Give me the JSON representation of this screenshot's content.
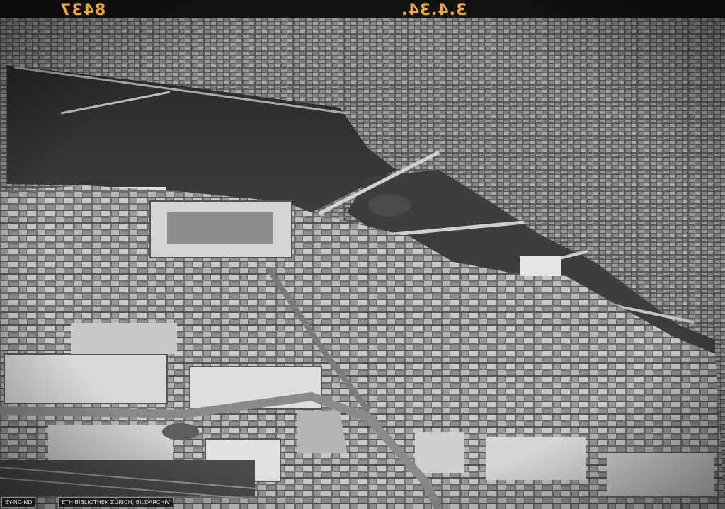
{
  "photo": {
    "negative_number_left": "8437",
    "negative_number_right": "3.4.34.",
    "license_badge": "BY-NC-ND",
    "credit": "ETH-BIBLIOTHEK ZÜRICH, BILDARCHIV"
  },
  "colors": {
    "lake": "#2f2f2f",
    "river": "#3a3a3a",
    "buildings_light": "#cfcfcf",
    "buildings_dark": "#5a5a5a",
    "annotation": "#e8a93a"
  }
}
